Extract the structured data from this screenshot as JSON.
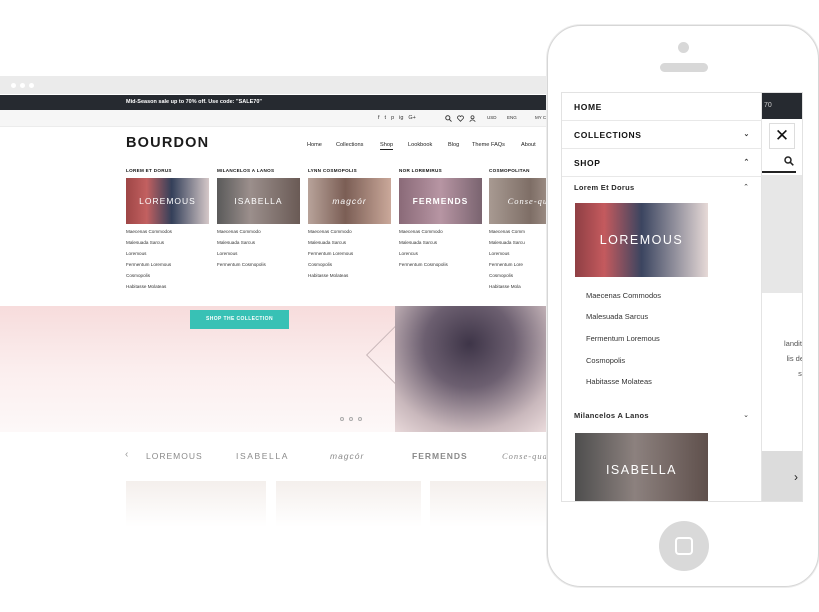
{
  "colors": {
    "accent": "#38c1b5",
    "dark_bar": "#262a30",
    "hero_pink": "#f7dcdc"
  },
  "desktop": {
    "promo_text": "Mid-Season sale up to 70% off. Use code: \"SALE70\"",
    "util_icons": [
      "f",
      "t",
      "p",
      "ig",
      "G+"
    ],
    "util_right_icons": [
      "search-icon",
      "heart-icon",
      "user-icon"
    ],
    "currency": "USD",
    "language": "ENG",
    "account": "MY C",
    "logo": "BOURDON",
    "nav": [
      "Home",
      "Collections",
      "Shop",
      "Blog",
      "Lookbook",
      "Theme FAQs",
      "About"
    ],
    "nav_active": "Shop",
    "mega": [
      {
        "title": "LOREM ET DORUS",
        "image_label": "LOREMOUS",
        "links": [
          "Maecenas Commodos",
          "Malesuada Sarcus",
          "Loremous",
          "Fermentum Loremous",
          "Cosmopolis",
          "Habitasse Molateas"
        ]
      },
      {
        "title": "MILANCELOS A LANOS",
        "image_label": "ISABELLA",
        "links": [
          "Maecenas Commodo",
          "Malesuada Sarcus",
          "Loremous",
          "Fermentum Cosmopolis"
        ]
      },
      {
        "title": "LYNN COSMOPOLIS",
        "image_label": "magcór",
        "links": [
          "Maecenas Commodo",
          "Malesuada Sarcus",
          "Fermentum Loremous",
          "Cosmopolis",
          "Habitasse Molateas"
        ]
      },
      {
        "title": "NOR LOREMIRUS",
        "image_label": "FERMENDS",
        "links": [
          "Maecenas Commodo",
          "Malesuada Sarcus",
          "Lorencus",
          "Fermentum Cosmopolis"
        ]
      },
      {
        "title": "COSMOPOLITAN",
        "image_label": "Conse-qua",
        "links": [
          "Maecenas Comm",
          "Malesuada Sarcu",
          "Loremous",
          "Fermentum Lore",
          "Cosmopolis",
          "Habitasse Mola"
        ]
      }
    ],
    "hero_button": "SHOP THE COLLECTION",
    "brands": [
      "LOREMOUS",
      "ISABELLA",
      "magcór",
      "FERMENDS",
      "Conse-qua"
    ]
  },
  "mobile": {
    "menu": [
      {
        "label": "HOME",
        "chevron": ""
      },
      {
        "label": "COLLECTIONS",
        "chevron": "⌄"
      },
      {
        "label": "SHOP",
        "chevron": "⌃"
      }
    ],
    "submenus": [
      {
        "title": "Lorem Et Dorus",
        "chevron": "⌃",
        "image_label": "LOREMOUS",
        "links": [
          "Maecenas Commodos",
          "Malesuada Sarcus",
          "Fermentum Loremous",
          "Cosmopolis",
          "Habitasse Molateas"
        ]
      },
      {
        "title": "Milancelos A Lanos",
        "chevron": "⌄",
        "image_label": "ISABELLA",
        "links": []
      }
    ],
    "bg_fragment": "70",
    "bg_text_lines": [
      "landit,",
      "lis de",
      "s."
    ],
    "close_symbol": "✕",
    "arrow_symbol": "›"
  }
}
